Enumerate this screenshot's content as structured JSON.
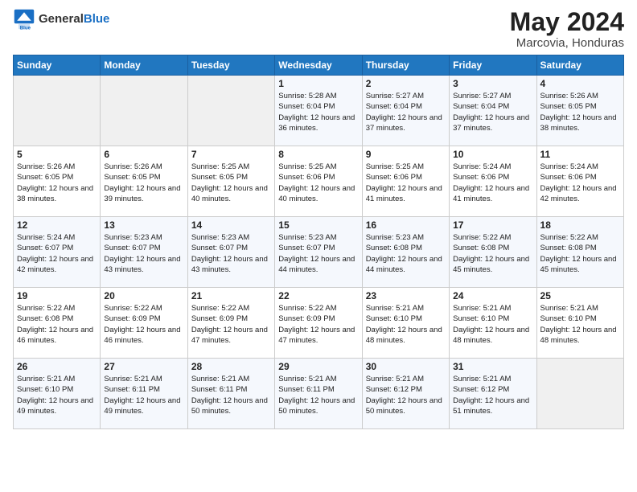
{
  "logo": {
    "general": "General",
    "blue": "Blue"
  },
  "header": {
    "month": "May 2024",
    "location": "Marcovia, Honduras"
  },
  "weekdays": [
    "Sunday",
    "Monday",
    "Tuesday",
    "Wednesday",
    "Thursday",
    "Friday",
    "Saturday"
  ],
  "weeks": [
    [
      {
        "day": "",
        "sunrise": "",
        "sunset": "",
        "daylight": ""
      },
      {
        "day": "",
        "sunrise": "",
        "sunset": "",
        "daylight": ""
      },
      {
        "day": "",
        "sunrise": "",
        "sunset": "",
        "daylight": ""
      },
      {
        "day": "1",
        "sunrise": "Sunrise: 5:28 AM",
        "sunset": "Sunset: 6:04 PM",
        "daylight": "Daylight: 12 hours and 36 minutes."
      },
      {
        "day": "2",
        "sunrise": "Sunrise: 5:27 AM",
        "sunset": "Sunset: 6:04 PM",
        "daylight": "Daylight: 12 hours and 37 minutes."
      },
      {
        "day": "3",
        "sunrise": "Sunrise: 5:27 AM",
        "sunset": "Sunset: 6:04 PM",
        "daylight": "Daylight: 12 hours and 37 minutes."
      },
      {
        "day": "4",
        "sunrise": "Sunrise: 5:26 AM",
        "sunset": "Sunset: 6:05 PM",
        "daylight": "Daylight: 12 hours and 38 minutes."
      }
    ],
    [
      {
        "day": "5",
        "sunrise": "Sunrise: 5:26 AM",
        "sunset": "Sunset: 6:05 PM",
        "daylight": "Daylight: 12 hours and 38 minutes."
      },
      {
        "day": "6",
        "sunrise": "Sunrise: 5:26 AM",
        "sunset": "Sunset: 6:05 PM",
        "daylight": "Daylight: 12 hours and 39 minutes."
      },
      {
        "day": "7",
        "sunrise": "Sunrise: 5:25 AM",
        "sunset": "Sunset: 6:05 PM",
        "daylight": "Daylight: 12 hours and 40 minutes."
      },
      {
        "day": "8",
        "sunrise": "Sunrise: 5:25 AM",
        "sunset": "Sunset: 6:06 PM",
        "daylight": "Daylight: 12 hours and 40 minutes."
      },
      {
        "day": "9",
        "sunrise": "Sunrise: 5:25 AM",
        "sunset": "Sunset: 6:06 PM",
        "daylight": "Daylight: 12 hours and 41 minutes."
      },
      {
        "day": "10",
        "sunrise": "Sunrise: 5:24 AM",
        "sunset": "Sunset: 6:06 PM",
        "daylight": "Daylight: 12 hours and 41 minutes."
      },
      {
        "day": "11",
        "sunrise": "Sunrise: 5:24 AM",
        "sunset": "Sunset: 6:06 PM",
        "daylight": "Daylight: 12 hours and 42 minutes."
      }
    ],
    [
      {
        "day": "12",
        "sunrise": "Sunrise: 5:24 AM",
        "sunset": "Sunset: 6:07 PM",
        "daylight": "Daylight: 12 hours and 42 minutes."
      },
      {
        "day": "13",
        "sunrise": "Sunrise: 5:23 AM",
        "sunset": "Sunset: 6:07 PM",
        "daylight": "Daylight: 12 hours and 43 minutes."
      },
      {
        "day": "14",
        "sunrise": "Sunrise: 5:23 AM",
        "sunset": "Sunset: 6:07 PM",
        "daylight": "Daylight: 12 hours and 43 minutes."
      },
      {
        "day": "15",
        "sunrise": "Sunrise: 5:23 AM",
        "sunset": "Sunset: 6:07 PM",
        "daylight": "Daylight: 12 hours and 44 minutes."
      },
      {
        "day": "16",
        "sunrise": "Sunrise: 5:23 AM",
        "sunset": "Sunset: 6:08 PM",
        "daylight": "Daylight: 12 hours and 44 minutes."
      },
      {
        "day": "17",
        "sunrise": "Sunrise: 5:22 AM",
        "sunset": "Sunset: 6:08 PM",
        "daylight": "Daylight: 12 hours and 45 minutes."
      },
      {
        "day": "18",
        "sunrise": "Sunrise: 5:22 AM",
        "sunset": "Sunset: 6:08 PM",
        "daylight": "Daylight: 12 hours and 45 minutes."
      }
    ],
    [
      {
        "day": "19",
        "sunrise": "Sunrise: 5:22 AM",
        "sunset": "Sunset: 6:08 PM",
        "daylight": "Daylight: 12 hours and 46 minutes."
      },
      {
        "day": "20",
        "sunrise": "Sunrise: 5:22 AM",
        "sunset": "Sunset: 6:09 PM",
        "daylight": "Daylight: 12 hours and 46 minutes."
      },
      {
        "day": "21",
        "sunrise": "Sunrise: 5:22 AM",
        "sunset": "Sunset: 6:09 PM",
        "daylight": "Daylight: 12 hours and 47 minutes."
      },
      {
        "day": "22",
        "sunrise": "Sunrise: 5:22 AM",
        "sunset": "Sunset: 6:09 PM",
        "daylight": "Daylight: 12 hours and 47 minutes."
      },
      {
        "day": "23",
        "sunrise": "Sunrise: 5:21 AM",
        "sunset": "Sunset: 6:10 PM",
        "daylight": "Daylight: 12 hours and 48 minutes."
      },
      {
        "day": "24",
        "sunrise": "Sunrise: 5:21 AM",
        "sunset": "Sunset: 6:10 PM",
        "daylight": "Daylight: 12 hours and 48 minutes."
      },
      {
        "day": "25",
        "sunrise": "Sunrise: 5:21 AM",
        "sunset": "Sunset: 6:10 PM",
        "daylight": "Daylight: 12 hours and 48 minutes."
      }
    ],
    [
      {
        "day": "26",
        "sunrise": "Sunrise: 5:21 AM",
        "sunset": "Sunset: 6:10 PM",
        "daylight": "Daylight: 12 hours and 49 minutes."
      },
      {
        "day": "27",
        "sunrise": "Sunrise: 5:21 AM",
        "sunset": "Sunset: 6:11 PM",
        "daylight": "Daylight: 12 hours and 49 minutes."
      },
      {
        "day": "28",
        "sunrise": "Sunrise: 5:21 AM",
        "sunset": "Sunset: 6:11 PM",
        "daylight": "Daylight: 12 hours and 50 minutes."
      },
      {
        "day": "29",
        "sunrise": "Sunrise: 5:21 AM",
        "sunset": "Sunset: 6:11 PM",
        "daylight": "Daylight: 12 hours and 50 minutes."
      },
      {
        "day": "30",
        "sunrise": "Sunrise: 5:21 AM",
        "sunset": "Sunset: 6:12 PM",
        "daylight": "Daylight: 12 hours and 50 minutes."
      },
      {
        "day": "31",
        "sunrise": "Sunrise: 5:21 AM",
        "sunset": "Sunset: 6:12 PM",
        "daylight": "Daylight: 12 hours and 51 minutes."
      },
      {
        "day": "",
        "sunrise": "",
        "sunset": "",
        "daylight": ""
      }
    ]
  ]
}
